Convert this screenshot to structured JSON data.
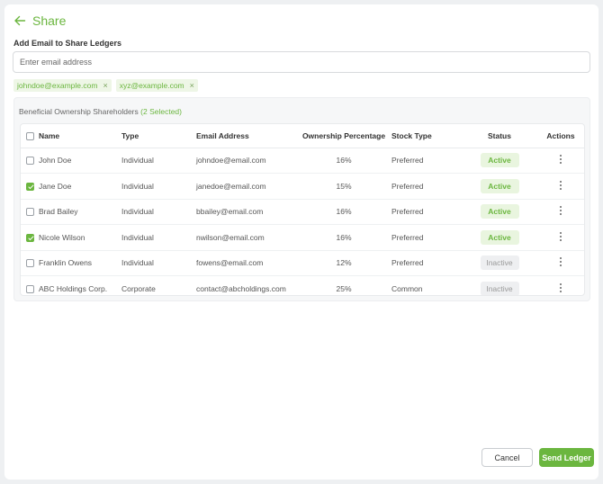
{
  "header": {
    "title": "Share",
    "back_icon": "arrow-left-icon"
  },
  "share_form": {
    "label": "Add Email to Share Ledgers",
    "email_placeholder": "Enter email address",
    "chips": [
      {
        "email": "johndoe@example.com",
        "close": "×"
      },
      {
        "email": "xyz@example.com",
        "close": "×"
      }
    ]
  },
  "panel": {
    "title": "Beneficial Ownership Shareholders",
    "selected_text": "(2 Selected)"
  },
  "table": {
    "columns": {
      "name": "Name",
      "type": "Type",
      "email": "Email Address",
      "ownership": "Ownership Percentage",
      "stock_type": "Stock Type",
      "status": "Status",
      "actions": "Actions"
    },
    "rows": [
      {
        "checked": false,
        "name": "John Doe",
        "type": "Individual",
        "email": "johndoe@email.com",
        "ownership": "16%",
        "stock_type": "Preferred",
        "status": "Active"
      },
      {
        "checked": true,
        "name": "Jane Doe",
        "type": "Individual",
        "email": "janedoe@email.com",
        "ownership": "15%",
        "stock_type": "Preferred",
        "status": "Active"
      },
      {
        "checked": false,
        "name": "Brad Bailey",
        "type": "Individual",
        "email": "bbailey@email.com",
        "ownership": "16%",
        "stock_type": "Preferred",
        "status": "Active"
      },
      {
        "checked": true,
        "name": "Nicole Wilson",
        "type": "Individual",
        "email": "nwilson@email.com",
        "ownership": "16%",
        "stock_type": "Preferred",
        "status": "Active"
      },
      {
        "checked": false,
        "name": "Franklin Owens",
        "type": "Individual",
        "email": "fowens@email.com",
        "ownership": "12%",
        "stock_type": "Preferred",
        "status": "Inactive"
      },
      {
        "checked": false,
        "name": "ABC Holdings Corp.",
        "type": "Corporate",
        "email": "contact@abcholdings.com",
        "ownership": "25%",
        "stock_type": "Common",
        "status": "Inactive"
      }
    ]
  },
  "footer": {
    "cancel_label": "Cancel",
    "send_label": "Send Ledger"
  },
  "colors": {
    "accent": "#6bb63f",
    "active_bg": "#e9f5df",
    "inactive_bg": "#eeeff1"
  }
}
